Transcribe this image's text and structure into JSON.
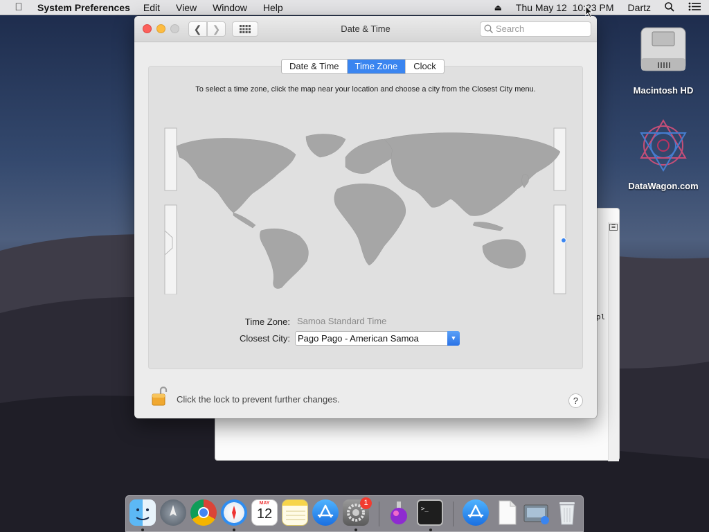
{
  "menubar": {
    "app_name": "System Preferences",
    "menus": [
      "Edit",
      "View",
      "Window",
      "Help"
    ],
    "datetime": "Thu May 12  10:23 PM",
    "user": "Dartz"
  },
  "window": {
    "title": "Date & Time",
    "search_placeholder": "Search",
    "tabs": [
      {
        "label": "Date & Time",
        "active": false
      },
      {
        "label": "Time Zone",
        "active": true
      },
      {
        "label": "Clock",
        "active": false
      }
    ],
    "instructions": "To select a time zone, click the map near your location and choose a city from the Closest City menu.",
    "time_zone_label": "Time Zone:",
    "time_zone_value": "Samoa Standard Time",
    "closest_city_label": "Closest City:",
    "closest_city_value": "Pago Pago - American Samoa",
    "lock_text": "Click the lock to prevent further changes.",
    "help": "?"
  },
  "desktop": {
    "items": [
      {
        "label": "Macintosh HD",
        "icon": "hard-drive-icon"
      },
      {
        "label": "DataWagon.com",
        "icon": "datawagon-logo-icon"
      }
    ]
  },
  "background_window": {
    "fragment": "pl"
  },
  "dock": {
    "calendar_month": "MAY",
    "calendar_day": "12",
    "badge_count": "1",
    "apps": [
      "finder-icon",
      "launchpad-icon",
      "chrome-icon",
      "safari-icon",
      "calendar-icon",
      "notes-icon",
      "app-store-icon",
      "system-preferences-icon",
      "potion-app-icon",
      "terminal-icon",
      "app-store-download-icon",
      "document-icon",
      "screenshot-icon",
      "trash-icon"
    ]
  },
  "colors": {
    "accent": "#3a85f0",
    "map_land": "#a6a6a6",
    "selected_marker": "#3a85f0"
  }
}
